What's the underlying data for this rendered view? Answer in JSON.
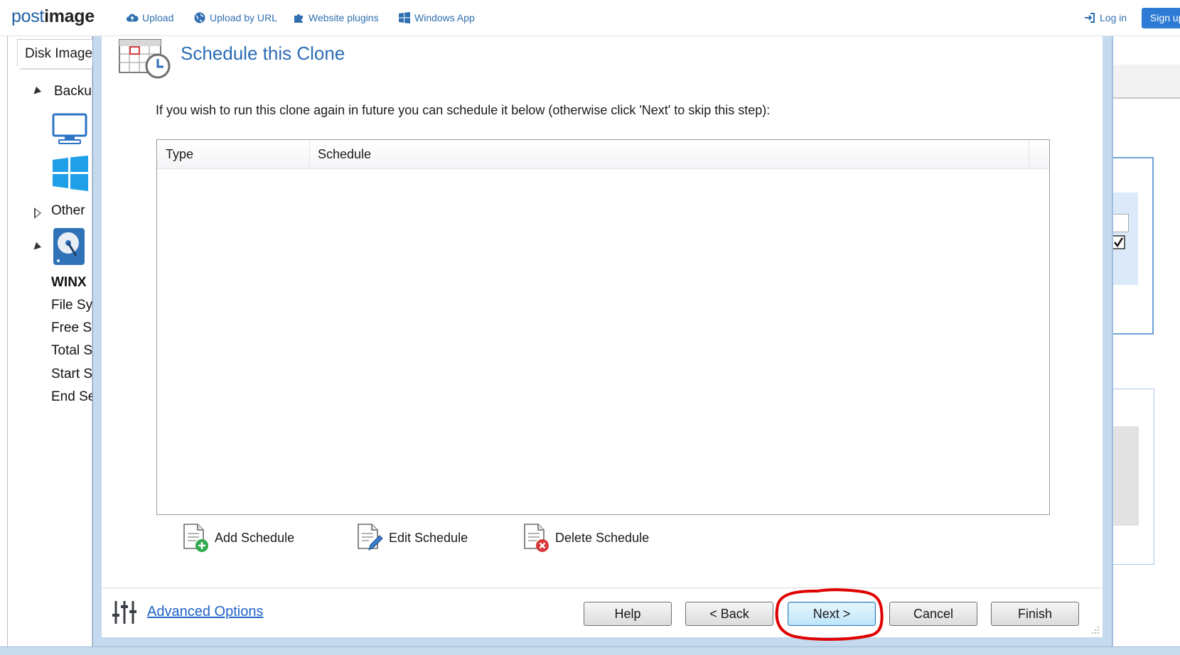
{
  "topbar": {
    "logo_light": "post",
    "logo_bold": "image",
    "nav": [
      {
        "label": "Upload",
        "icon": "cloud-upload-icon"
      },
      {
        "label": "Upload by URL",
        "icon": "globe-icon"
      },
      {
        "label": "Website plugins",
        "icon": "puzzle-icon"
      },
      {
        "label": "Windows App",
        "icon": "windows-icon"
      }
    ],
    "login": "Log in",
    "signup": "Sign up"
  },
  "background_app": {
    "tab": "Disk Image",
    "tree": {
      "backup_label": "Backu",
      "other_label": "Other",
      "disk_label": "WINX",
      "fields": [
        "File Sy",
        "Free Sp",
        "Total S",
        "Start S",
        "End Se"
      ]
    }
  },
  "dialog": {
    "title": "Schedule this Clone",
    "instruction": "If you wish to run this clone again in future you can schedule it below (otherwise click 'Next' to skip this step):",
    "table": {
      "columns": [
        "Type",
        "Schedule"
      ],
      "rows": []
    },
    "actions": {
      "add": "Add Schedule",
      "edit": "Edit Schedule",
      "delete": "Delete Schedule"
    },
    "advanced_options": "Advanced Options",
    "buttons": {
      "help": "Help",
      "back": "< Back",
      "next": "Next >",
      "cancel": "Cancel",
      "finish": "Finish"
    },
    "highlight_color": "#e00000"
  },
  "colors": {
    "brand": "#2e7bd6",
    "title_blue": "#2b6cb5",
    "link_blue": "#1e63c6",
    "dialog_frame": "#c5d9ef"
  }
}
